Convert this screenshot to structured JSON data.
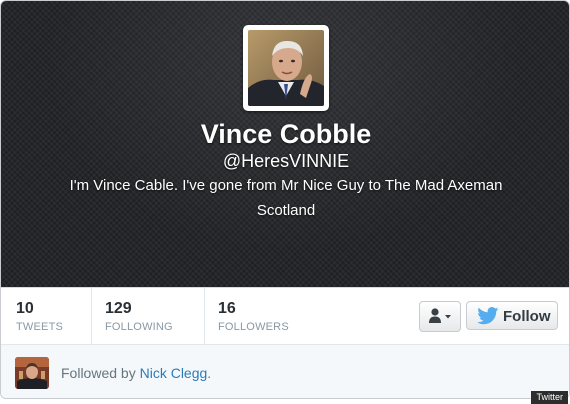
{
  "profile": {
    "name": "Vince Cobble",
    "handle": "@HeresVINNIE",
    "bio": "I'm Vince Cable. I've gone from Mr Nice Guy to The Mad Axeman",
    "location": "Scotland"
  },
  "stats": [
    {
      "value": "10",
      "label": "TWEETS"
    },
    {
      "value": "129",
      "label": "FOLLOWING"
    },
    {
      "value": "16",
      "label": "FOLLOWERS"
    }
  ],
  "actions": {
    "user_menu_icon": "person-icon",
    "follow_label": "Follow",
    "follow_icon": "twitter-bird-icon"
  },
  "footer": {
    "followed_by_prefix": "Followed by",
    "followed_by_name": "Nick Clegg",
    "followed_by_suffix": "."
  },
  "watermark": "Twitter",
  "colors": {
    "header_bg": "#24262a",
    "link": "#2b7bb9",
    "twitter_blue": "#55acee"
  }
}
